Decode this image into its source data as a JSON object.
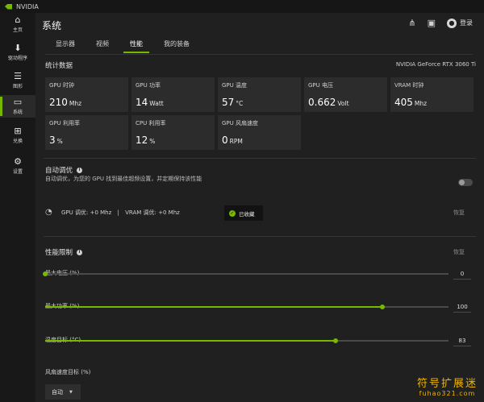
{
  "window": {
    "title": "NVIDIA"
  },
  "sidebar": {
    "items": [
      {
        "label": "主页",
        "icon": "home-icon"
      },
      {
        "label": "驱动程序",
        "icon": "download-icon"
      },
      {
        "label": "图形",
        "icon": "sliders-icon"
      },
      {
        "label": "系统",
        "icon": "monitor-icon"
      },
      {
        "label": "兑换",
        "icon": "gift-icon"
      },
      {
        "label": "设置",
        "icon": "gear-icon"
      }
    ],
    "active_index": 3
  },
  "header": {
    "title": "系统",
    "login_label": "登录"
  },
  "tabs": [
    {
      "label": "显示器"
    },
    {
      "label": "视频"
    },
    {
      "label": "性能"
    },
    {
      "label": "我的装备"
    }
  ],
  "active_tab_index": 2,
  "stats": {
    "section_title": "统计数据",
    "gpu_model": "NVIDIA GeForce RTX 3060 Ti",
    "cards": [
      {
        "label": "GPU 时钟",
        "value": "210",
        "unit": "Mhz"
      },
      {
        "label": "GPU 功率",
        "value": "14",
        "unit": "Watt"
      },
      {
        "label": "GPU 温度",
        "value": "57",
        "unit": "°C"
      },
      {
        "label": "GPU 电压",
        "value": "0.662",
        "unit": "Volt"
      },
      {
        "label": "VRAM 时钟",
        "value": "405",
        "unit": "Mhz"
      },
      {
        "label": "GPU 利用率",
        "value": "3",
        "unit": "%"
      },
      {
        "label": "CPU 利用率",
        "value": "12",
        "unit": "%"
      },
      {
        "label": "GPU 风扇速度",
        "value": "0",
        "unit": "RPM"
      }
    ]
  },
  "auto_tune": {
    "title": "自动调优",
    "description": "自动调优，为您的 GPU 找到最佳超频设置，并定期保持该性能",
    "enabled": false,
    "gpu_tune_text": "GPU 调优:  +0 Mhz",
    "separator": "|",
    "vram_tune_text": "VRAM 调优:  +0 Mhz",
    "toast_text": "已收藏",
    "restore_label": "恢复"
  },
  "limits": {
    "title": "性能限制",
    "restore_label": "恢复",
    "sliders": [
      {
        "label": "最大电压 (%)",
        "value": "0",
        "fraction": 0.0
      },
      {
        "label": "最大功率 (%)",
        "value": "100",
        "fraction": 0.835
      },
      {
        "label": "温度目标 (°C)",
        "value": "83",
        "fraction": 0.72
      }
    ],
    "fan": {
      "label": "风扇速度目标 (%)",
      "dropdown_value": "自动"
    }
  },
  "watermark": {
    "line1": "符号扩展迷",
    "line2": "fuhao321.com"
  },
  "colors": {
    "accent": "#76b900",
    "background": "#202020",
    "card": "#2c2c2c",
    "sidebar": "#181818"
  }
}
